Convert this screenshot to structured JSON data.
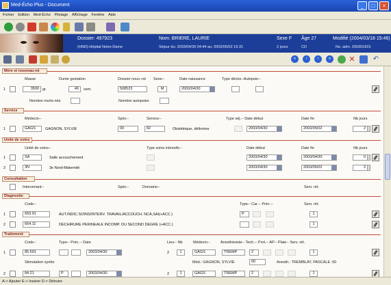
{
  "window": {
    "title": "Med-Écho Plus - Document"
  },
  "menu": [
    "Fichier",
    "Edition",
    "Med-Écho",
    "Pilotage",
    "Affichage",
    "Fenêtre",
    "Aide"
  ],
  "toolbar_icons": [
    "green-circle-icon",
    "gray-circle-icon",
    "red-flag-icon",
    "home-icon",
    "color-wheel-icon",
    "key-icon",
    "users-icon",
    "printer-icon",
    "book-icon",
    "monitor-icon"
  ],
  "patient": {
    "dossier_label": "Dossier: 497923",
    "hospital": "(HND)-Hôpital Notre-Dame",
    "name_label": "Nom: BRIERE, LAURIE",
    "sejour": "Séjour du: 2003/04/30 04:44  au: 2003/05/02 16:31",
    "sexe": "Sexe  F",
    "age": "Âge  27",
    "duration": "2 jours",
    "code": "CD",
    "modifie": "Modifié (2004/03/18 15:46)",
    "no_adm": "No. adm.   200301815"
  },
  "sections": {
    "mere": {
      "title": "Mère et nouveau-né",
      "headers": [
        "Masse",
        "Durée gestation",
        "Dossier nouv.-né",
        "Sexe--",
        "Date naissance",
        "Type décès--Autopsie--"
      ],
      "row_index": "1",
      "masse": "3500",
      "masse_unit": "gr.",
      "gestation": "40",
      "gestation_unit": "sem.",
      "dossier": "508523",
      "sexe": "M",
      "date": "2003/04/30",
      "nombre_morts": "Nombre morts-nés",
      "nombre_autopsies": "Nombre autopsies"
    },
    "service": {
      "title": "Service",
      "headers": [
        "Médecin--",
        "Spéc--",
        "Service--",
        "Type séj.-- Date début",
        "Date fin",
        "Nb jours"
      ],
      "row_index": "1",
      "medecin_code": "GAGS",
      "medecin_name": "GAGNON, SYLVIE",
      "spec": "00",
      "service_code": "82",
      "service_name": "Obstétrique, délivrées",
      "date_debut": "2003/04/30",
      "date_fin": "2003/05/02",
      "nb_jours": "2"
    },
    "unite": {
      "title": "Unité de soins",
      "headers": [
        "Unité de soins--",
        "Type soins intensifs--",
        "Date début",
        "Date fin",
        "Nb jours"
      ],
      "rows": [
        {
          "index": "1",
          "code": "SA",
          "name": "Salle accouchement",
          "date_debut": "2003/04/30",
          "date_fin": "2003/04/30",
          "nb_jours": "0"
        },
        {
          "index": "2",
          "code": "3N",
          "name": "3e Nord-Maternité",
          "date_debut": "2003/04/30",
          "date_fin": "2003/05/02",
          "nb_jours": "2"
        }
      ]
    },
    "consultation": {
      "title": "Consultation",
      "headers": [
        "Intervenant--",
        "Spéc--",
        "Domaine--",
        "Serv. rét."
      ]
    },
    "diagnostic": {
      "title": "Diagnostic",
      "headers": [
        "Code--",
        "Type-- Car.-- Préc.--",
        "Serv. rét."
      ],
      "rows": [
        {
          "index": "1",
          "code": "659.91",
          "desc": "AUT.INDIC.SOINS/INTERV. TRAVAIL/ACCOUCH. NCA,SAI(+ACC.)",
          "type": "P",
          "serv": "1"
        },
        {
          "index": "2",
          "code": "664.11",
          "desc": "DECHIRURE PERINEALE INCOMP. DU SECOND DEGRE (+ACC.)",
          "type": "",
          "serv": "1"
        }
      ]
    },
    "traitement": {
      "title": "Traitement",
      "headers": [
        "Code--",
        "Type-- Préc.-- Date",
        "Lieu-- Nb",
        "Médecin--",
        "Anesthésiste-- Tech.-- Prot.-- AP-- Plaie-- Serv. rét."
      ],
      "rows": [
        {
          "index": "1",
          "code": "85.591",
          "date": "2003/04/30",
          "lieu": "2",
          "nb": "1",
          "medecin": "GAGS",
          "anesth": "TREMP",
          "tech": "2",
          "serv": "1"
        },
        {
          "index": "2",
          "code": "84.21",
          "type": "P",
          "date": "2003/04/30",
          "lieu": "2",
          "nb": "1",
          "medecin": "GAGS",
          "anesth": "TREMP",
          "tech": "2",
          "serv": "1"
        }
      ],
      "row1_desc": "Stimulation syntto",
      "row1_med": "Méd.: GAGNON, SYLVIE",
      "row1_num": "60",
      "row1_anesth": "Anesth.: TREMBLAY, PASCALE  :50"
    }
  },
  "status": "A-> Ajouter E-> Insérer D-> Détruire"
}
